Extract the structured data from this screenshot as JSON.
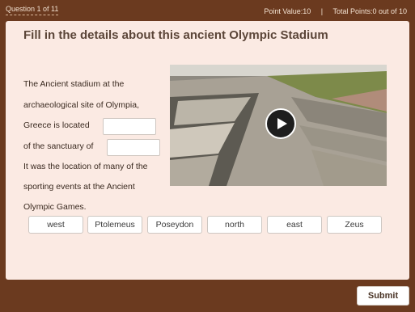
{
  "header": {
    "question_counter": "Question 1 of 11",
    "point_value": "Point Value:10",
    "separator": "|",
    "total_points": "Total Points:0 out of 10"
  },
  "question": {
    "title": "Fill in the details about this ancient Olympic Stadium",
    "lines": [
      "The Ancient stadium at the",
      "archaeological site of Olympia,",
      "Greece is located",
      "of the sanctuary of",
      "It was the location of many of the",
      "sporting events at the Ancient",
      "Olympic Games."
    ],
    "blank_1": "",
    "blank_2": ""
  },
  "video": {
    "play_icon": "play-icon",
    "colors": {
      "stone": "#a8a195",
      "shadow": "#5d5a52",
      "grass": "#7d8a4a",
      "sky": "#d8d6cf"
    }
  },
  "choices": [
    "west",
    "Ptolemeus",
    "Poseydon",
    "north",
    "east",
    "Zeus"
  ],
  "actions": {
    "submit_label": "Submit"
  },
  "colors": {
    "frame": "#6b3a1f",
    "card": "#fbeae3",
    "heading": "#5b4538"
  }
}
